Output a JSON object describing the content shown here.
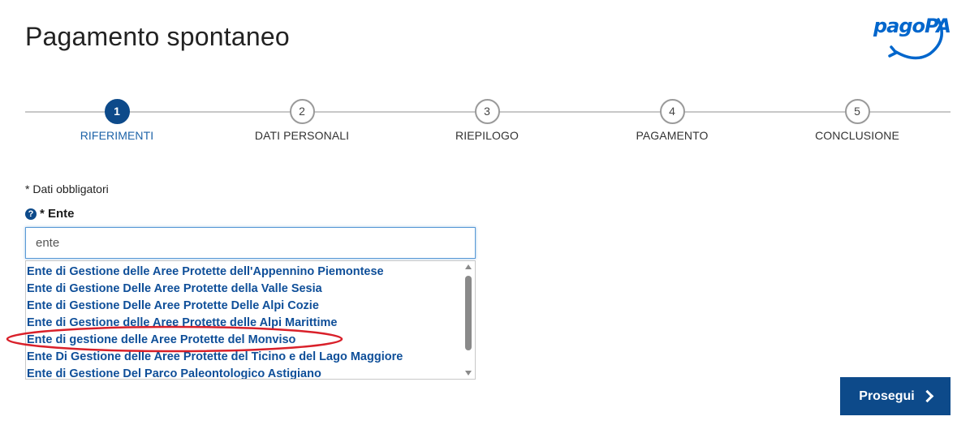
{
  "header": {
    "title": "Pagamento spontaneo",
    "logo_text": "pagoPA"
  },
  "stepper": {
    "steps": [
      {
        "number": "1",
        "label": "RIFERIMENTI",
        "active": true
      },
      {
        "number": "2",
        "label": "DATI PERSONALI",
        "active": false
      },
      {
        "number": "3",
        "label": "RIEPILOGO",
        "active": false
      },
      {
        "number": "4",
        "label": "PAGAMENTO",
        "active": false
      },
      {
        "number": "5",
        "label": "CONCLUSIONE",
        "active": false
      }
    ]
  },
  "form": {
    "required_note": "* Dati obbligatori",
    "ente_label": "* Ente",
    "ente_input_value": "ente",
    "ente_options": [
      "Ente di Gestione delle Aree Protette dell'Appennino Piemontese",
      "Ente di Gestione Delle Aree Protette della Valle Sesia",
      "Ente di Gestione Delle Aree Protette Delle Alpi Cozie",
      "Ente di Gestione delle Aree Protette delle Alpi Marittime",
      "Ente di gestione delle Aree Protette del Monviso",
      "Ente Di Gestione delle Aree Protette del Ticino e del Lago Maggiore",
      "Ente di Gestione Del Parco Paleontologico Astigiano"
    ],
    "highlighted_option_index": 4
  },
  "actions": {
    "next_label": "Prosegui"
  },
  "colors": {
    "primary": "#0d4a8a",
    "link": "#0f4f99",
    "highlight_ellipse": "#d9202a",
    "logo": "#0066cc"
  }
}
